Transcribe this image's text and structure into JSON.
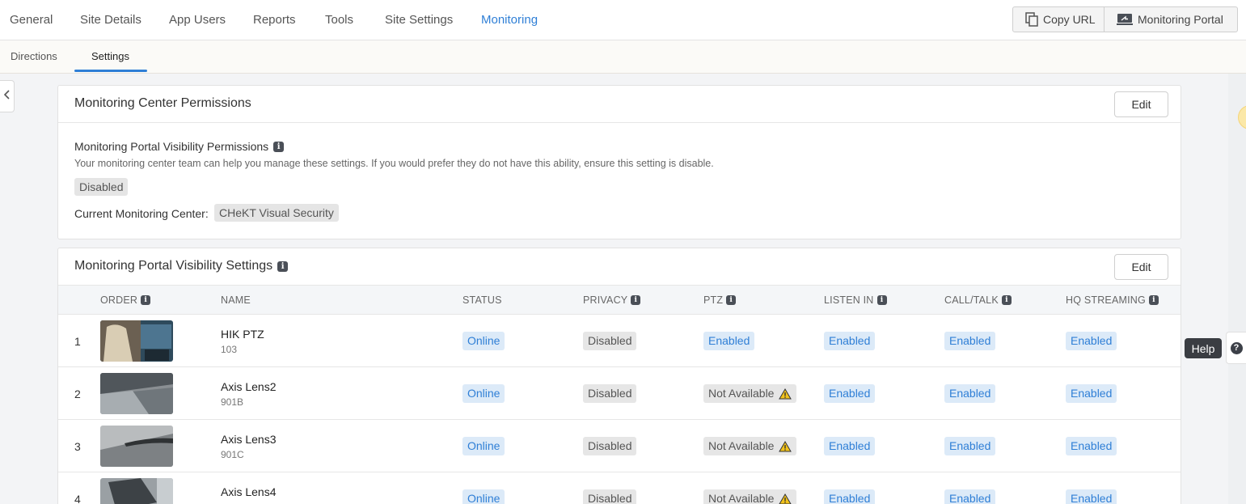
{
  "nav": {
    "tabs": [
      {
        "label": "General"
      },
      {
        "label": "Site Details"
      },
      {
        "label": "App Users"
      },
      {
        "label": "Reports"
      },
      {
        "label": "Tools"
      },
      {
        "label": "Site Settings"
      },
      {
        "label": "Monitoring"
      }
    ],
    "active_tab": "Monitoring",
    "copy_url_label": "Copy URL",
    "monitoring_portal_label": "Monitoring Portal"
  },
  "subnav": {
    "tabs": [
      {
        "label": "Directions"
      },
      {
        "label": "Settings"
      }
    ],
    "active_tab": "Settings"
  },
  "permissions_card": {
    "title": "Monitoring Center Permissions",
    "edit_label": "Edit",
    "visibility_label": "Monitoring Portal Visibility Permissions",
    "description": "Your monitoring center team can help you manage these settings. If you would prefer they do not have this ability, ensure this setting is disable.",
    "status": "Disabled",
    "current_center_label": "Current Monitoring Center:",
    "current_center": "CHeKT Visual Security"
  },
  "visibility_card": {
    "title": "Monitoring Portal Visibility Settings",
    "edit_label": "Edit",
    "columns": [
      "ORDER",
      "NAME",
      "STATUS",
      "PRIVACY",
      "PTZ",
      "LISTEN IN",
      "CALL/TALK",
      "HQ STREAMING"
    ],
    "rows": [
      {
        "order": "1",
        "name": "HIK PTZ",
        "id": "103",
        "status": "Online",
        "privacy": "Disabled",
        "ptz": "Enabled",
        "listen_in": "Enabled",
        "call_talk": "Enabled",
        "hq_streaming": "Enabled"
      },
      {
        "order": "2",
        "name": "Axis Lens2",
        "id": "901B",
        "status": "Online",
        "privacy": "Disabled",
        "ptz": "Not Available",
        "listen_in": "Enabled",
        "call_talk": "Enabled",
        "hq_streaming": "Enabled"
      },
      {
        "order": "3",
        "name": "Axis Lens3",
        "id": "901C",
        "status": "Online",
        "privacy": "Disabled",
        "ptz": "Not Available",
        "listen_in": "Enabled",
        "call_talk": "Enabled",
        "hq_streaming": "Enabled"
      },
      {
        "order": "4",
        "name": "Axis Lens4",
        "id": "",
        "status": "Online",
        "privacy": "Disabled",
        "ptz": "Not Available",
        "listen_in": "Enabled",
        "call_talk": "Enabled",
        "hq_streaming": "Enabled"
      }
    ]
  },
  "help": {
    "label": "Help"
  },
  "colors": {
    "accent": "#2f7fd6",
    "enabled_bg": "#dceaf8",
    "disabled_bg": "#e6e6e6",
    "warning": "#f2c21a"
  },
  "icons": {
    "info": "info-icon",
    "warning": "warning-icon",
    "copy": "copy-icon",
    "portal": "monitor-icon",
    "collapse": "chevron-left-icon",
    "help": "question-icon"
  }
}
